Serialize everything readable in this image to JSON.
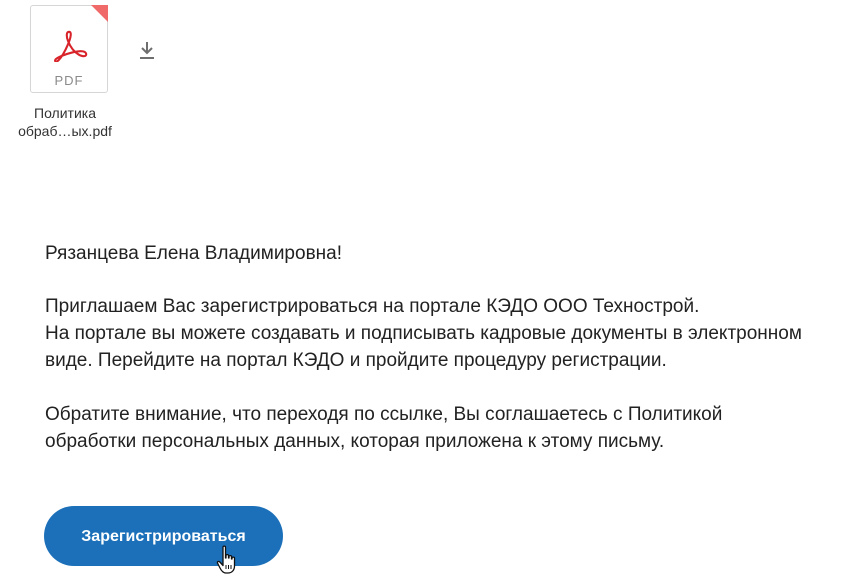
{
  "attachment": {
    "file_type": "PDF",
    "file_name_line1": "Политика",
    "file_name_line2": "обраб…ых.pdf",
    "icon": "pdf-icon",
    "download_icon": "download-icon",
    "accent_color": "#f06a6a",
    "logo_color": "#d8232a"
  },
  "message": {
    "greeting": "Рязанцева Елена Владимировна!",
    "paragraph1": {
      "line1": "Приглашаем Вас зарегистрироваться на портале КЭДО ООО Технострой.",
      "line2": "На портале вы можете создавать и подписывать кадровые документы в электронном",
      "line3": "виде. Перейдите на портал КЭДО и пройдите процедуру регистрации."
    },
    "paragraph2": {
      "line1": "Обратите внимание, что переходя по ссылке, Вы соглашаетесь с Политикой",
      "line2": "обработки персональных данных, которая приложена к этому письму."
    }
  },
  "register_button": {
    "label": "Зарегистрироваться",
    "color": "#1b70b9"
  },
  "cursor": {
    "icon": "hand-pointer-icon"
  }
}
